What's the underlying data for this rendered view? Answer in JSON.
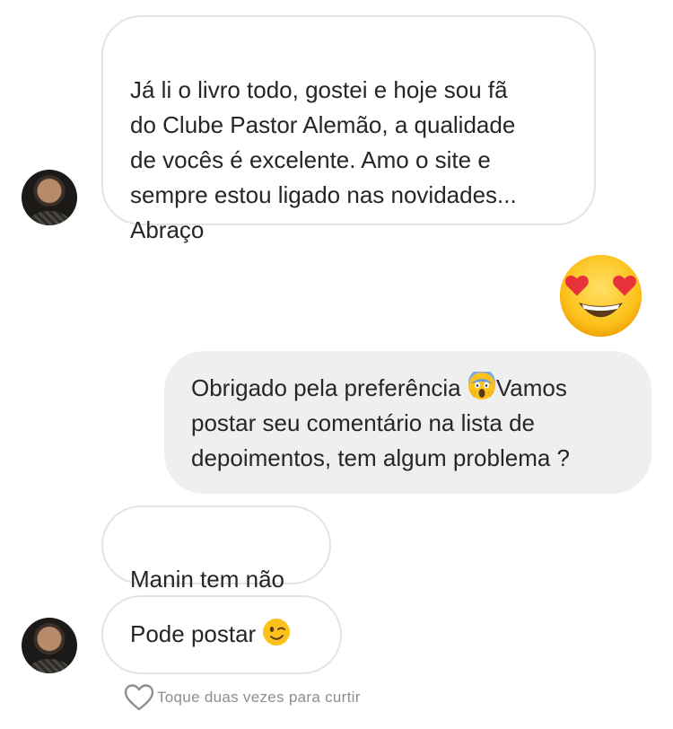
{
  "messages": [
    {
      "id": "msg1",
      "side": "incoming",
      "text": "Já li o livro todo, gostei e hoje sou fã\ndo Clube Pastor Alemão, a qualidade\nde vocês é excelente. Amo o site e\nsempre estou ligado nas novidades...\nAbraço"
    },
    {
      "id": "msg2",
      "side": "outgoing",
      "emoji": "heart-eyes-emoji"
    },
    {
      "id": "msg3",
      "side": "outgoing",
      "text_before": "Obrigado pela preferência ",
      "emoji": "screaming-face-emoji",
      "text_after": "Vamos\npostar seu comentário na lista de\ndepoimentos, tem algum problema ?"
    },
    {
      "id": "msg4",
      "side": "incoming",
      "text": "Manin tem não"
    },
    {
      "id": "msg5",
      "side": "incoming",
      "text": "Pode postar ",
      "emoji": "winking-face-emoji"
    }
  ],
  "like_hint": "Toque duas vezes para curtir",
  "icons": {
    "like": "heart-outline-icon"
  },
  "colors": {
    "text": "#262626",
    "incoming_border": "#e4e4e4",
    "outgoing_bg": "#efefef",
    "hint": "#8e8e8e",
    "emoji_yellow": "#fcc21b",
    "emoji_red": "#e8323a"
  }
}
